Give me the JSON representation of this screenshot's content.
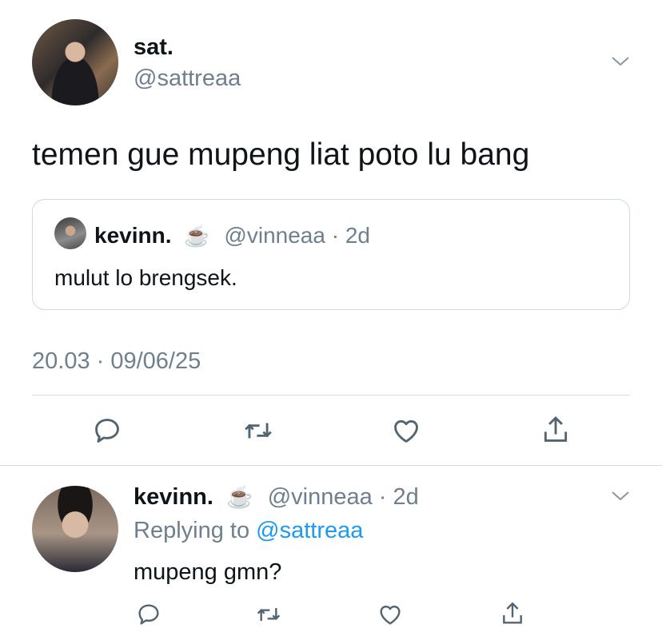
{
  "tweet": {
    "display_name": "sat.",
    "handle": "@sattreaa",
    "text": "temen gue mupeng liat poto lu bang",
    "timestamp": "20.03 · 09/06/25"
  },
  "quoted": {
    "display_name": "kevinn.",
    "emoji": "☕",
    "handle": "@vinneaa",
    "age": "· 2d",
    "text": "mulut lo brengsek."
  },
  "reply": {
    "display_name": "kevinn.",
    "emoji": "☕",
    "handle": "@vinneaa",
    "age": "· 2d",
    "replying_label": "Replying to",
    "replying_handle": "@sattreaa",
    "text": "mupeng gmn?"
  },
  "icons": [
    "chevron-down-icon",
    "reply-icon",
    "retweet-icon",
    "like-icon",
    "share-icon"
  ]
}
